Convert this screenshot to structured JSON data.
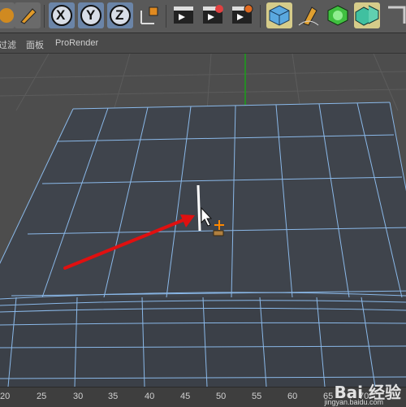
{
  "menubar": {
    "items": [
      {
        "label": "过滤"
      },
      {
        "label": "面板"
      },
      {
        "label": "ProRender"
      }
    ]
  },
  "toolbar": {
    "axis_x_label": "X",
    "axis_y_label": "Y",
    "axis_z_label": "Z"
  },
  "ruler": {
    "ticks": [
      "20",
      "25",
      "30",
      "35",
      "40",
      "45",
      "50",
      "55",
      "60",
      "65",
      "70"
    ]
  },
  "watermark": {
    "brand": "Bai 经验",
    "url": "jingyan.baidu.com"
  },
  "colors": {
    "accent": "#ff8800",
    "grid_line": "#8ab8e8",
    "arrow": "#e01010",
    "axis_green": "#19a019"
  }
}
